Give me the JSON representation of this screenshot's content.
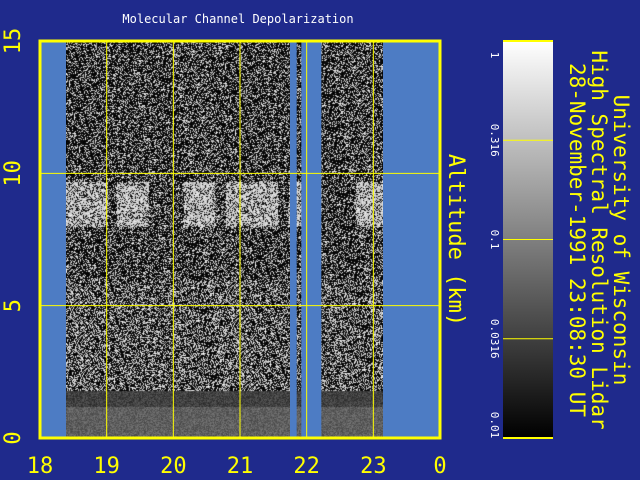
{
  "chart_data": {
    "type": "heatmap",
    "title": "Molecular Channel Depolarization",
    "ylabel": "Altitude (km)",
    "x_ticks": [
      "18",
      "19",
      "20",
      "21",
      "22",
      "23",
      "0"
    ],
    "y_ticks": [
      "0",
      "5",
      "10",
      "15"
    ],
    "xlim": [
      18,
      24
    ],
    "ylim": [
      0,
      15
    ],
    "grid": true,
    "colorbar": {
      "ticks": [
        "1",
        "0.316",
        "0.1",
        "0.0316",
        "0.01"
      ],
      "scale": "log",
      "range": [
        0.01,
        1
      ],
      "colormap": "grayscale"
    },
    "data_gaps_hours": [
      [
        18.0,
        18.36
      ],
      [
        21.75,
        21.85
      ],
      [
        21.92,
        22.22
      ],
      [
        23.16,
        24.0
      ]
    ],
    "cloud_layer_km": [
      8.0,
      9.7
    ]
  },
  "side_text": {
    "line1": "University of Wisconsin",
    "line2": "High Spectral Resolution Lidar",
    "line3": "28-November-1991 23:08:30 UT"
  },
  "colors": {
    "background": "#1f2a8c",
    "no_data": "#4d7cc4",
    "axis": "#ffff00",
    "text": "#ffffff"
  }
}
